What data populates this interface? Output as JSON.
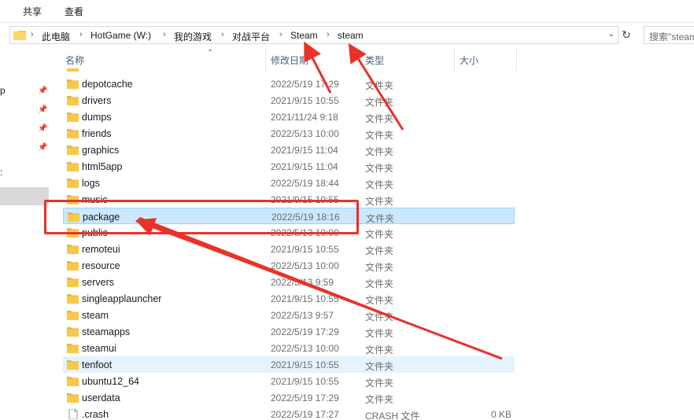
{
  "ribbon": {
    "tabs": [
      "共享",
      "查看"
    ]
  },
  "address": {
    "crumbs": [
      "此电脑",
      "HotGame (W:)",
      "我的游戏",
      "对战平台",
      "Steam",
      "steam"
    ],
    "search_placeholder": "搜索\"steam\""
  },
  "nav": {
    "partial_labels": [
      "p",
      ":"
    ]
  },
  "columns": {
    "name": "名称",
    "date": "修改日期",
    "type": "类型",
    "size": "大小"
  },
  "rows": [
    {
      "name": "depotcache",
      "date": "2022/5/19 17:29",
      "type": "文件夹",
      "size": "",
      "kind": "folder"
    },
    {
      "name": "drivers",
      "date": "2021/9/15 10:55",
      "type": "文件夹",
      "size": "",
      "kind": "folder"
    },
    {
      "name": "dumps",
      "date": "2021/11/24 9:18",
      "type": "文件夹",
      "size": "",
      "kind": "folder"
    },
    {
      "name": "friends",
      "date": "2022/5/13 10:00",
      "type": "文件夹",
      "size": "",
      "kind": "folder"
    },
    {
      "name": "graphics",
      "date": "2021/9/15 11:04",
      "type": "文件夹",
      "size": "",
      "kind": "folder"
    },
    {
      "name": "html5app",
      "date": "2021/9/15 11:04",
      "type": "文件夹",
      "size": "",
      "kind": "folder"
    },
    {
      "name": "logs",
      "date": "2022/5/19 18:44",
      "type": "文件夹",
      "size": "",
      "kind": "folder"
    },
    {
      "name": "music",
      "date": "2021/9/15 10:55",
      "type": "文件夹",
      "size": "",
      "kind": "folder"
    },
    {
      "name": "package",
      "date": "2022/5/19 18:16",
      "type": "文件夹",
      "size": "",
      "kind": "folder",
      "state": "selected"
    },
    {
      "name": "public",
      "date": "2022/5/13 10:00",
      "type": "文件夹",
      "size": "",
      "kind": "folder"
    },
    {
      "name": "remoteui",
      "date": "2021/9/15 10:55",
      "type": "文件夹",
      "size": "",
      "kind": "folder"
    },
    {
      "name": "resource",
      "date": "2022/5/13 10:00",
      "type": "文件夹",
      "size": "",
      "kind": "folder"
    },
    {
      "name": "servers",
      "date": "2022/5/13 9:59",
      "type": "文件夹",
      "size": "",
      "kind": "folder"
    },
    {
      "name": "singleapplauncher",
      "date": "2021/9/15 10:55",
      "type": "文件夹",
      "size": "",
      "kind": "folder"
    },
    {
      "name": "steam",
      "date": "2022/5/13 9:57",
      "type": "文件夹",
      "size": "",
      "kind": "folder"
    },
    {
      "name": "steamapps",
      "date": "2022/5/19 17:29",
      "type": "文件夹",
      "size": "",
      "kind": "folder"
    },
    {
      "name": "steamui",
      "date": "2022/5/13 10:00",
      "type": "文件夹",
      "size": "",
      "kind": "folder"
    },
    {
      "name": "tenfoot",
      "date": "2021/9/15 10:55",
      "type": "文件夹",
      "size": "",
      "kind": "folder",
      "state": "hover"
    },
    {
      "name": "ubuntu12_64",
      "date": "2021/9/15 10:55",
      "type": "文件夹",
      "size": "",
      "kind": "folder"
    },
    {
      "name": "userdata",
      "date": "2022/5/19 17:29",
      "type": "文件夹",
      "size": "",
      "kind": "folder"
    },
    {
      "name": ".crash",
      "date": "2022/5/19 17:27",
      "type": "CRASH 文件",
      "size": "0 KB",
      "kind": "file"
    }
  ],
  "colors": {
    "annotation": "#e8322a",
    "selected_bg": "#cce8ff",
    "hover_bg": "#e5f3ff",
    "folder": "#f7c948"
  }
}
